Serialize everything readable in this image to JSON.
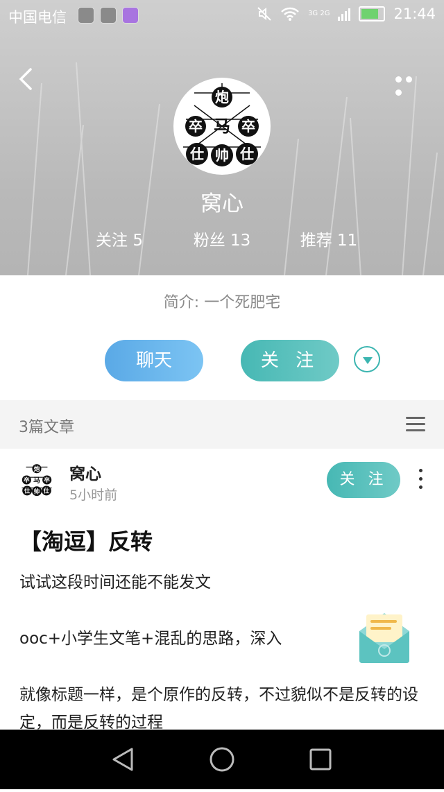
{
  "status_bar": {
    "carrier": "中国电信",
    "network": "3G 2G",
    "time": "21:44"
  },
  "profile": {
    "name": "窝心",
    "stats": [
      {
        "label": "关注 5"
      },
      {
        "label": "粉丝 13"
      },
      {
        "label": "推荐 11"
      }
    ],
    "bio": "简介: 一个死肥宅",
    "avatar_glyphs": [
      "炮",
      "卒",
      "马",
      "卒",
      "仕",
      "帅",
      "仕"
    ]
  },
  "actions": {
    "chat_label": "聊天",
    "follow_label": "关 注"
  },
  "articles": {
    "count_label": "3篇文章"
  },
  "post": {
    "author": "窝心",
    "time": "5小时前",
    "follow_label": "关 注",
    "title": "【淘逗】反转",
    "paragraphs": [
      "试试这段时间还能不能发文",
      "ooc+小学生文笔+混乱的思路，深入",
      "就像标题一样，是个原作的反转，不过貌似不是反转的设定，而是反转的过程"
    ]
  },
  "colors": {
    "accent_teal": "#47b8b4",
    "accent_blue": "#5aa9e6"
  }
}
